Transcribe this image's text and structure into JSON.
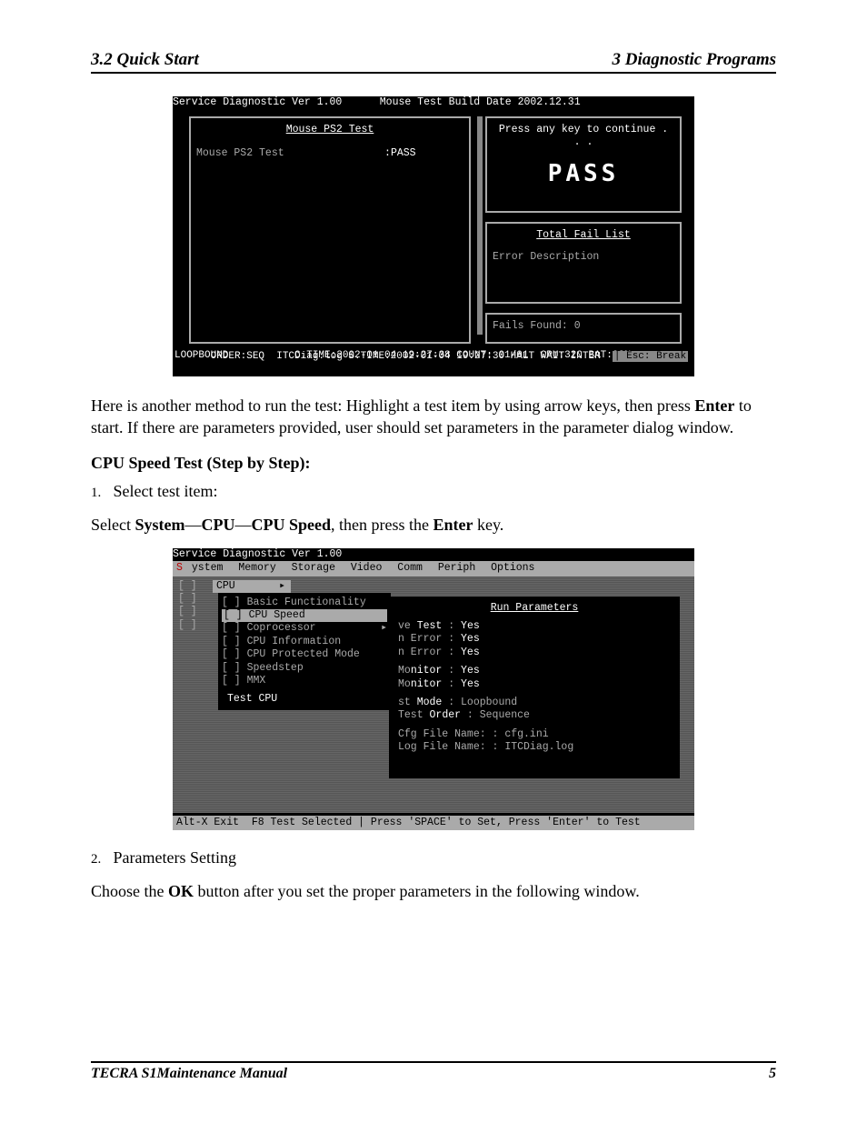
{
  "header": {
    "left": "3.2 Quick Start",
    "right": "3  Diagnostic Programs"
  },
  "footer": {
    "manual": "TECRA S1Maintenance Manual",
    "page": "5"
  },
  "scr1": {
    "title_left": "Service Diagnostic Ver 1.00",
    "title_right": "Mouse Test Build Date 2002.12.31",
    "panel_title": "Mouse PS2 Test",
    "test_line_label": "Mouse PS2 Test",
    "test_line_result": ":PASS",
    "right_top_msg": "Press any key to continue . . .",
    "big_pass": "PASS",
    "fail_list_header": "Total Fail List",
    "fail_cols": "Error  Description",
    "fails_found": "Fails Found: 0",
    "bottom1": "LOOPBOUND           C.TIME:2002-01-04 19:27:38 COUNT: 01/01  CPU:32C BAT:98%",
    "bottom2_a": "ORDER:SEQ  ITCDiag.log S.TIME:2002-01-04 19:27:30 HALT WAIT INTER  ",
    "bottom2_b": "| Esc: Break"
  },
  "para1_a": "Here is another method to run the test: Highlight a test item by using arrow keys, then press ",
  "para1_b": "Enter",
  "para1_c": " to start. If there are parameters provided, user should set parameters in the parameter dialog window.",
  "sub_heading": "CPU Speed Test (Step by Step):",
  "step1_num": "1.",
  "step1": "Select test item:",
  "step1_line_a": "Select ",
  "step1_line_b": "System",
  "step1_line_c": "—",
  "step1_line_d": "CPU",
  "step1_line_e": "—",
  "step1_line_f": "CPU Speed",
  "step1_line_g": ", then press the ",
  "step1_line_h": "Enter",
  "step1_line_i": " key.",
  "scr2": {
    "title": "Service Diagnostic Ver 1.00",
    "menu": {
      "m1": "System",
      "m2": "Memory",
      "m3": "Storage",
      "m4": "Video",
      "m5": "Comm",
      "m6": "Periph",
      "m7": "Options"
    },
    "col1": [
      "[ ]",
      "[ ]",
      "[ ]",
      "[ ]"
    ],
    "cpu_label": "CPU",
    "submenu": {
      "i1": "[ ] Basic Functionality",
      "i2": "[ ] CPU Speed",
      "i3": "[ ] Coprocessor",
      "i4": "[ ] CPU Information",
      "i5": "[ ] CPU Protected Mode",
      "i6": "[ ] Speedstep",
      "i7": "[ ] MMX",
      "footer": "Test CPU"
    },
    "params": {
      "header": "Run Parameters",
      "l1a": "ve ",
      "l1b": "Test",
      "l1c": " : ",
      "l1d": "Yes",
      "l2a": "n Error : ",
      "l2b": "Yes",
      "l3a": "n Error : ",
      "l3b": "Yes",
      "l4a": "Mo",
      "l4b": "nitor",
      "l4c": " : ",
      "l4d": "Yes",
      "l5a": "Mo",
      "l5b": "nitor",
      "l5c": " : ",
      "l5d": "Yes",
      "l6a": "st ",
      "l6b": "Mode",
      "l6c": " : Loopbound",
      "l7a": "Test ",
      "l7b": "Order",
      "l7c": " : Sequence",
      "l8": "Cfg File Name: : cfg.ini",
      "l9": "Log File Name: : ITCDiag.log"
    },
    "footer_bar": "Alt-X Exit  F8 Test Selected | Press 'SPACE' to Set, Press 'Enter' to Test"
  },
  "step2_num": "2.",
  "step2": "Parameters Setting",
  "step2_line_a": "Choose the ",
  "step2_line_b": "OK",
  "step2_line_c": " button after you set the proper parameters in the following window."
}
